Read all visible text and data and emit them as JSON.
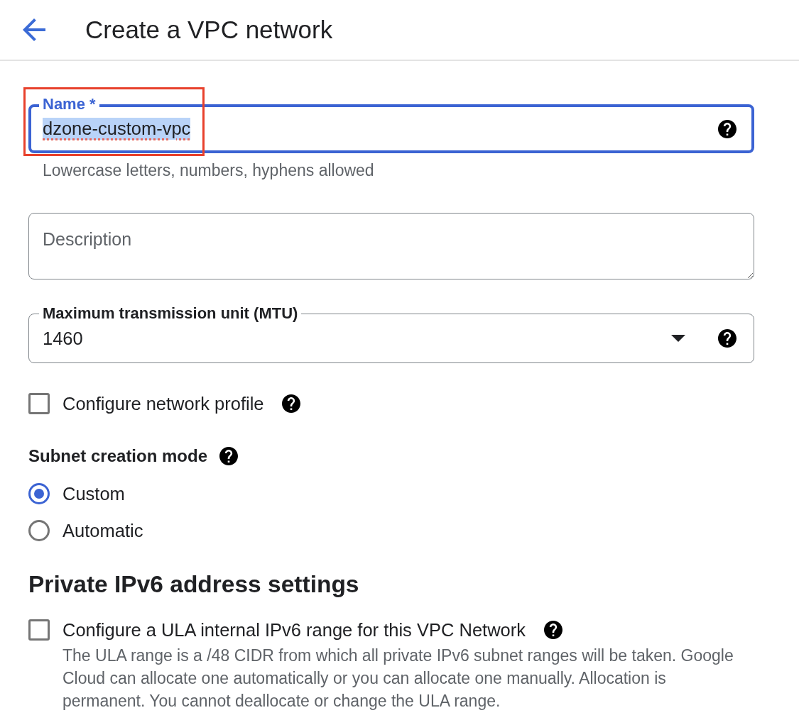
{
  "header": {
    "title": "Create a VPC network"
  },
  "name_field": {
    "label": "Name *",
    "value": "dzone-custom-vpc",
    "focused": true,
    "value_selected": true,
    "spelling_flagged": true,
    "highlighted": true,
    "help": true,
    "hint": "Lowercase letters, numbers, hyphens allowed"
  },
  "description_field": {
    "placeholder": "Description"
  },
  "mtu_field": {
    "label": "Maximum transmission unit (MTU)",
    "value": "1460",
    "focused": false,
    "help": true
  },
  "network_profile": {
    "label": "Configure network profile",
    "checked": false,
    "help": true
  },
  "subnet_creation_mode": {
    "title": "Subnet creation mode",
    "help": true,
    "options": [
      {
        "label": "Custom",
        "selected": true
      },
      {
        "label": "Automatic",
        "selected": false
      }
    ]
  },
  "ipv6_section": {
    "heading": "Private IPv6 address settings",
    "ula_checkbox": {
      "label": "Configure a ULA internal IPv6 range for this VPC Network",
      "checked": false,
      "help": true,
      "description": "The ULA range is a /48 CIDR from which all private IPv6 subnet ranges will be taken. Google Cloud can allocate one automatically or you can allocate one manually. Allocation is permanent. You cannot deallocate or change the ULA range."
    }
  }
}
